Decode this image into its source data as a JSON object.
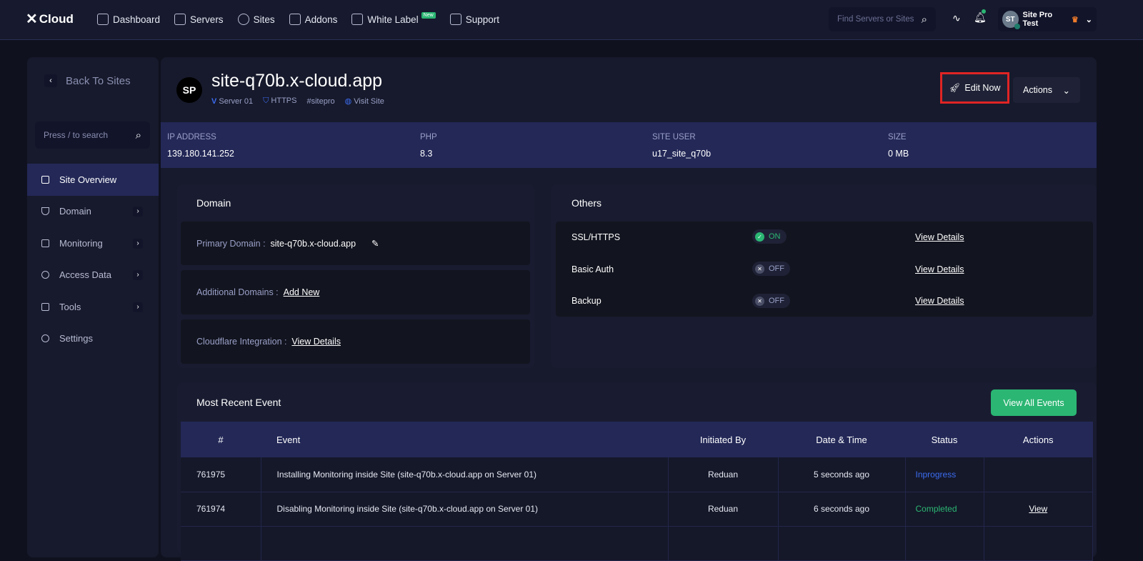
{
  "brand": "Cloud",
  "nav": [
    {
      "label": "Dashboard"
    },
    {
      "label": "Servers"
    },
    {
      "label": "Sites"
    },
    {
      "label": "Addons"
    },
    {
      "label": "White Label",
      "badge": "New"
    },
    {
      "label": "Support"
    }
  ],
  "search": {
    "placeholder": "Find Servers or Sites"
  },
  "user": {
    "initials": "ST",
    "name": "Site Pro Test"
  },
  "sidebar": {
    "back": "Back To Sites",
    "search_placeholder": "Press / to search",
    "items": [
      {
        "label": "Site Overview"
      },
      {
        "label": "Domain"
      },
      {
        "label": "Monitoring"
      },
      {
        "label": "Access Data"
      },
      {
        "label": "Tools"
      },
      {
        "label": "Settings"
      }
    ]
  },
  "site": {
    "avatar": "SP",
    "title": "site-q70b.x-cloud.app",
    "server": "Server 01",
    "https": "HTTPS",
    "tag": "#sitepro",
    "visit": "Visit Site",
    "edit": "Edit Now",
    "actions": "Actions"
  },
  "info": [
    {
      "label": "IP ADDRESS",
      "value": "139.180.141.252"
    },
    {
      "label": "PHP",
      "value": "8.3"
    },
    {
      "label": "SITE USER",
      "value": "u17_site_q70b"
    },
    {
      "label": "SIZE",
      "value": "0 MB"
    }
  ],
  "domain": {
    "title": "Domain",
    "primary_label": "Primary Domain :",
    "primary_value": "site-q70b.x-cloud.app",
    "additional_label": "Additional Domains :",
    "add_new": "Add New",
    "cloudflare_label": "Cloudflare Integration :",
    "view_details": "View Details"
  },
  "others": {
    "title": "Others",
    "rows": [
      {
        "name": "SSL/HTTPS",
        "state": "ON",
        "link": "View Details"
      },
      {
        "name": "Basic Auth",
        "state": "OFF",
        "link": "View Details"
      },
      {
        "name": "Backup",
        "state": "OFF",
        "link": "View Details"
      }
    ]
  },
  "events": {
    "title": "Most Recent Event",
    "view_all": "View All Events",
    "columns": [
      "#",
      "Event",
      "Initiated By",
      "Date & Time",
      "Status",
      "Actions"
    ],
    "rows": [
      {
        "id": "761975",
        "event": "Installing Monitoring inside Site (site-q70b.x-cloud.app on Server 01)",
        "by": "Reduan",
        "time": "5 seconds ago",
        "status": "Inprogress",
        "action": ""
      },
      {
        "id": "761974",
        "event": "Disabling Monitoring inside Site (site-q70b.x-cloud.app on Server 01)",
        "by": "Reduan",
        "time": "6 seconds ago",
        "status": "Completed",
        "action": "View"
      }
    ]
  },
  "colors": {
    "accent": "#232857",
    "green": "#2bb673",
    "blue": "#3b6cf0",
    "red": "#e02424"
  }
}
